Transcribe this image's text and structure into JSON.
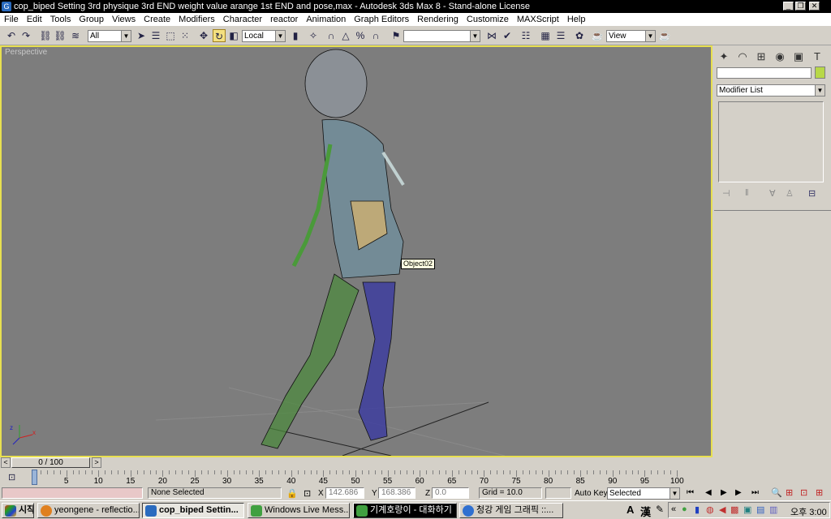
{
  "window": {
    "title": "cop_biped Setting 3rd physique 3rd END weight value arange 1st END and pose,max - Autodesk 3ds Max 8  - Stand-alone License",
    "minimize": "_",
    "restore": "❐",
    "close": "✕"
  },
  "menu": [
    "File",
    "Edit",
    "Tools",
    "Group",
    "Views",
    "Create",
    "Modifiers",
    "Character",
    "reactor",
    "Animation",
    "Graph Editors",
    "Rendering",
    "Customize",
    "MAXScript",
    "Help"
  ],
  "toolbar": {
    "selection_filter": "All",
    "ref_coord": "Local",
    "named_selection": "",
    "view_dropdown": "View"
  },
  "viewport": {
    "label": "Perspective",
    "tooltip": "Object02",
    "axis_x": "x",
    "axis_z": "z"
  },
  "command_panel": {
    "name_field": "",
    "modifier_list": "Modifier List",
    "color": "#b8d848"
  },
  "time_slider": {
    "value": "0 / 100",
    "prev": "<",
    "next": ">"
  },
  "trackbar": {
    "ticks": [
      "0",
      "5",
      "10",
      "15",
      "20",
      "25",
      "30",
      "35",
      "40",
      "45",
      "50",
      "55",
      "60",
      "65",
      "70",
      "75",
      "80",
      "85",
      "90",
      "95",
      "100"
    ]
  },
  "status": {
    "selection": "None Selected",
    "x_label": "X",
    "x_value": "142.686",
    "y_label": "Y",
    "y_value": "168.386",
    "z_label": "Z",
    "z_value": "0.0",
    "grid": "Grid = 10.0",
    "auto_key": "Auto Key",
    "key_mode": "Selected"
  },
  "taskbar": {
    "start": "시작",
    "tasks": [
      "yeongene - reflectio...",
      "cop_biped Settin...",
      "Windows Live Mess...",
      "기계호랑이 - 대화하기",
      "청강 게임 그래픽 ::..."
    ],
    "ime_a": "A",
    "ime_han": "漢",
    "clock": "오후 3:00",
    "expand": "«"
  }
}
